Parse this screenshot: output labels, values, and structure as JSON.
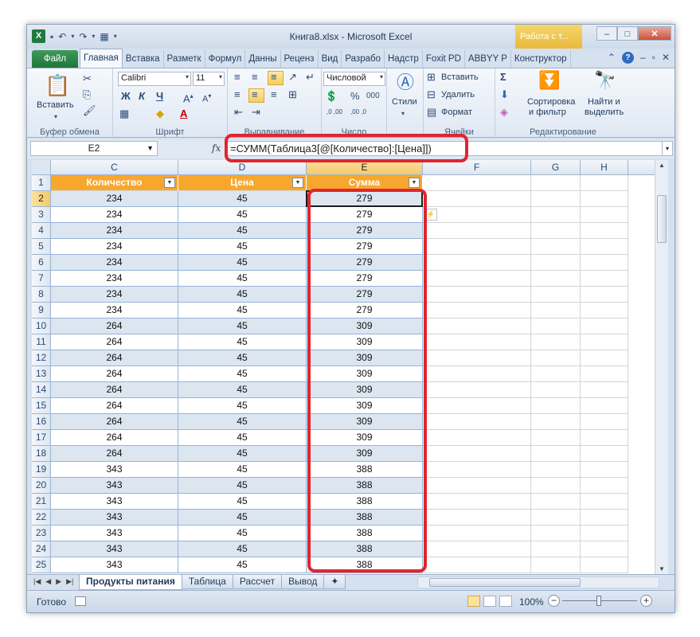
{
  "window": {
    "title": "Книга8.xlsx - Microsoft Excel",
    "context_title": "Работа с т...",
    "minimize_icon": "minimize-icon",
    "maximize_icon": "maximize-icon",
    "close_icon": "close-icon"
  },
  "tabs": [
    "Файл",
    "Главная",
    "Вставка",
    "Разметк",
    "Формул",
    "Данны",
    "Реценз",
    "Вид",
    "Разрабо",
    "Надстр",
    "Foxit PD",
    "ABBYY P",
    "Конструктор"
  ],
  "ribbon": {
    "clipboard": {
      "paste_label": "Вставить",
      "group_label": "Буфер обмена"
    },
    "font": {
      "name": "Calibri",
      "size": "11",
      "bold": "Ж",
      "italic": "К",
      "underline": "Ч",
      "group_label": "Шрифт"
    },
    "alignment": {
      "group_label": "Выравнивание"
    },
    "number": {
      "format": "Числовой",
      "percent": "%",
      "thousands": "000",
      "dec_inc": ",0 ,00",
      "dec_dec": ",00 ,0",
      "group_label": "Число"
    },
    "styles": {
      "label": "Стили"
    },
    "cells": {
      "insert": "Вставить",
      "delete": "Удалить",
      "format": "Формат",
      "group_label": "Ячейки"
    },
    "editing": {
      "sum": "Σ",
      "sort_filter_1": "Сортировка",
      "sort_filter_2": "и фильтр",
      "find_1": "Найти и",
      "find_2": "выделить",
      "group_label": "Редактирование"
    }
  },
  "formula_bar": {
    "name_box": "E2",
    "fx": "fx",
    "formula": "=СУММ(Таблица3[@[Количество]:[Цена]])"
  },
  "grid": {
    "columns": [
      "C",
      "D",
      "E",
      "F",
      "G",
      "H"
    ],
    "selected_column": "E",
    "selected_row": "2",
    "header_row_number": "1",
    "table_headers": [
      "Количество",
      "Цена",
      "Сумма"
    ],
    "rows": [
      {
        "n": "2",
        "qty": "234",
        "price": "45",
        "sum": "279"
      },
      {
        "n": "3",
        "qty": "234",
        "price": "45",
        "sum": "279"
      },
      {
        "n": "4",
        "qty": "234",
        "price": "45",
        "sum": "279"
      },
      {
        "n": "5",
        "qty": "234",
        "price": "45",
        "sum": "279"
      },
      {
        "n": "6",
        "qty": "234",
        "price": "45",
        "sum": "279"
      },
      {
        "n": "7",
        "qty": "234",
        "price": "45",
        "sum": "279"
      },
      {
        "n": "8",
        "qty": "234",
        "price": "45",
        "sum": "279"
      },
      {
        "n": "9",
        "qty": "234",
        "price": "45",
        "sum": "279"
      },
      {
        "n": "10",
        "qty": "264",
        "price": "45",
        "sum": "309"
      },
      {
        "n": "11",
        "qty": "264",
        "price": "45",
        "sum": "309"
      },
      {
        "n": "12",
        "qty": "264",
        "price": "45",
        "sum": "309"
      },
      {
        "n": "13",
        "qty": "264",
        "price": "45",
        "sum": "309"
      },
      {
        "n": "14",
        "qty": "264",
        "price": "45",
        "sum": "309"
      },
      {
        "n": "15",
        "qty": "264",
        "price": "45",
        "sum": "309"
      },
      {
        "n": "16",
        "qty": "264",
        "price": "45",
        "sum": "309"
      },
      {
        "n": "17",
        "qty": "264",
        "price": "45",
        "sum": "309"
      },
      {
        "n": "18",
        "qty": "264",
        "price": "45",
        "sum": "309"
      },
      {
        "n": "19",
        "qty": "343",
        "price": "45",
        "sum": "388"
      },
      {
        "n": "20",
        "qty": "343",
        "price": "45",
        "sum": "388"
      },
      {
        "n": "21",
        "qty": "343",
        "price": "45",
        "sum": "388"
      },
      {
        "n": "22",
        "qty": "343",
        "price": "45",
        "sum": "388"
      },
      {
        "n": "23",
        "qty": "343",
        "price": "45",
        "sum": "388"
      },
      {
        "n": "24",
        "qty": "343",
        "price": "45",
        "sum": "388"
      },
      {
        "n": "25",
        "qty": "343",
        "price": "45",
        "sum": "388"
      }
    ]
  },
  "sheets": [
    "Продукты питания",
    "Таблица",
    "Рассчет",
    "Вывод"
  ],
  "active_sheet": "Продукты питания",
  "status": {
    "ready": "Готово",
    "zoom": "100%",
    "zoom_minus": "−",
    "zoom_plus": "+"
  },
  "colors": {
    "table_header": "#f7a72d",
    "band": "#dce6f1",
    "highlight": "#e0262e"
  }
}
